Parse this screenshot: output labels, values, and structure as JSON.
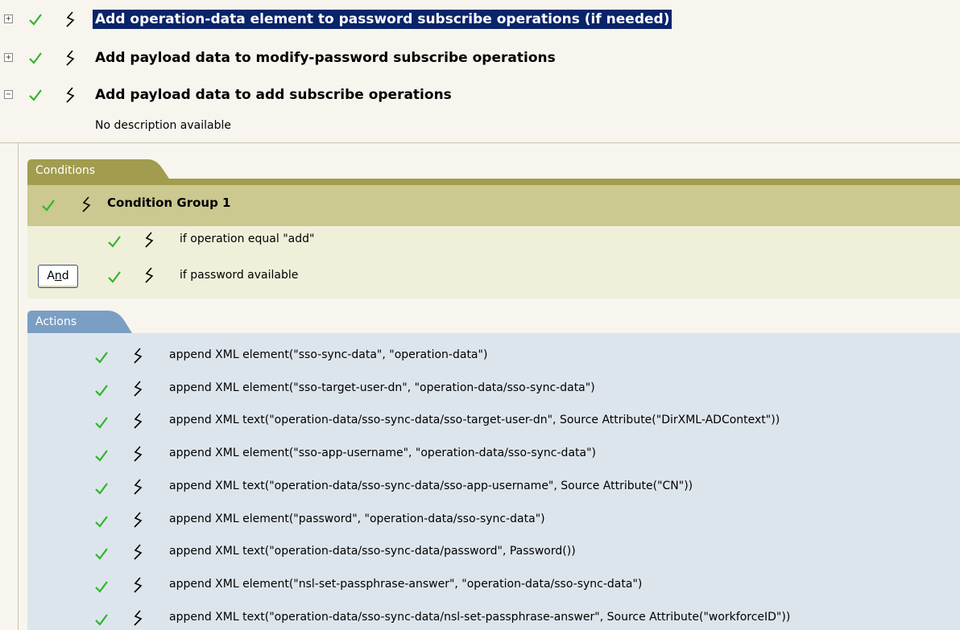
{
  "rules": [
    {
      "expander": "+",
      "title": "Add operation-data element to password subscribe operations (if needed)",
      "selected": true
    },
    {
      "expander": "+",
      "title": "Add payload data to modify-password subscribe operations",
      "selected": false
    },
    {
      "expander": "−",
      "title": "Add payload data to add subscribe operations",
      "selected": false
    }
  ],
  "description": "No description available",
  "conditions": {
    "tab_label": "Conditions",
    "group_label": "Condition Group 1",
    "items": [
      "if operation equal \"add\"",
      "if password available"
    ],
    "and_button": {
      "pre": "A",
      "underlined": "n",
      "post": "d"
    }
  },
  "actions": {
    "tab_label": "Actions",
    "items": [
      "append XML element(\"sso-sync-data\", \"operation-data\")",
      "append XML element(\"sso-target-user-dn\", \"operation-data/sso-sync-data\")",
      "append XML text(\"operation-data/sso-sync-data/sso-target-user-dn\", Source Attribute(\"DirXML-ADContext\"))",
      "append XML element(\"sso-app-username\", \"operation-data/sso-sync-data\")",
      "append XML text(\"operation-data/sso-sync-data/sso-app-username\", Source Attribute(\"CN\"))",
      "append XML element(\"password\", \"operation-data/sso-sync-data\")",
      "append XML text(\"operation-data/sso-sync-data/password\", Password())",
      "append XML element(\"nsl-set-passphrase-answer\", \"operation-data/sso-sync-data\")",
      "append XML text(\"operation-data/sso-sync-data/nsl-set-passphrase-answer\", Source Attribute(\"workforceID\"))"
    ]
  },
  "colors": {
    "check": "#2fb52f",
    "selection": "#0a246a",
    "conditions_tab": "#a19c4e",
    "conditions_header": "#cbc890",
    "actions_tab": "#7b9fc4",
    "actions_bg": "#dde5ec"
  }
}
